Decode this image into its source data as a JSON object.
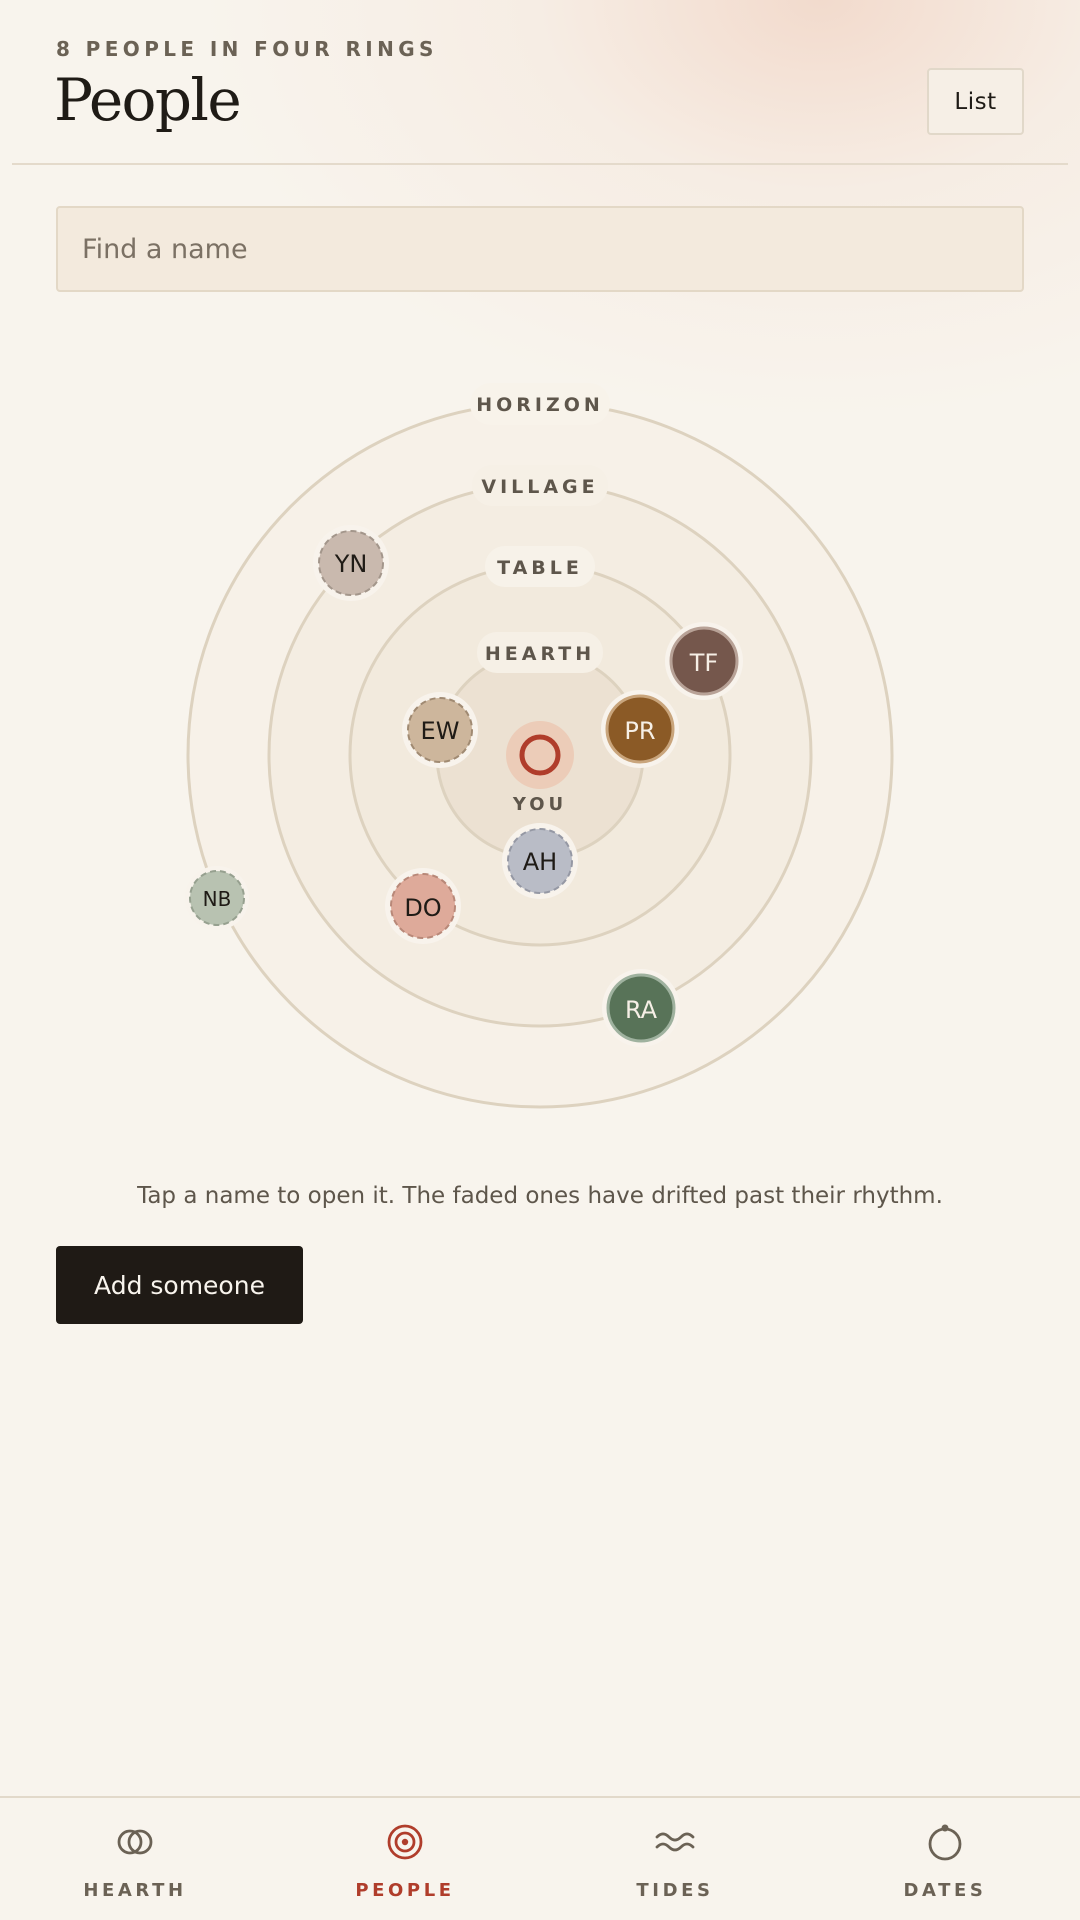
{
  "header": {
    "eyebrow": "8 PEOPLE IN FOUR RINGS",
    "title": "People",
    "list_button": "List"
  },
  "search": {
    "placeholder": "Find a name",
    "value": ""
  },
  "orbit": {
    "center_label": "YOU",
    "rings": [
      {
        "id": "hearth",
        "label": "HEARTH"
      },
      {
        "id": "table",
        "label": "TABLE"
      },
      {
        "id": "village",
        "label": "VILLAGE"
      },
      {
        "id": "horizon",
        "label": "HORIZON"
      }
    ],
    "people": [
      {
        "initials": "YN",
        "ring": "village",
        "faded": true,
        "color": "#c9b9ae"
      },
      {
        "initials": "TF",
        "ring": "village",
        "faded": false,
        "color": "#75574c"
      },
      {
        "initials": "EW",
        "ring": "table",
        "faded": true,
        "color": "#cdb69c"
      },
      {
        "initials": "PR",
        "ring": "table",
        "faded": false,
        "color": "#8b5a26"
      },
      {
        "initials": "AH",
        "ring": "hearth",
        "faded": true,
        "color": "#b9bcc6"
      },
      {
        "initials": "DO",
        "ring": "table",
        "faded": true,
        "color": "#deaa9a"
      },
      {
        "initials": "NB",
        "ring": "horizon",
        "faded": true,
        "color": "#b8c2b1"
      },
      {
        "initials": "RA",
        "ring": "horizon",
        "faded": false,
        "color": "#587358"
      }
    ]
  },
  "hint": "Tap a name to open it. The faded ones have drifted past their rhythm.",
  "add_button": "Add someone",
  "nav": {
    "items": [
      {
        "label": "HEARTH",
        "icon": "hearth-icon",
        "active": false
      },
      {
        "label": "PEOPLE",
        "icon": "people-target-icon",
        "active": true
      },
      {
        "label": "TIDES",
        "icon": "tides-wave-icon",
        "active": false
      },
      {
        "label": "DATES",
        "icon": "dates-ring-icon",
        "active": false
      }
    ]
  },
  "colors": {
    "accent": "#b03d2b",
    "background": "#f8f4ed",
    "ink": "#1f1b16",
    "muted": "#6b6255",
    "ring_stroke": "#ddd2bf"
  }
}
